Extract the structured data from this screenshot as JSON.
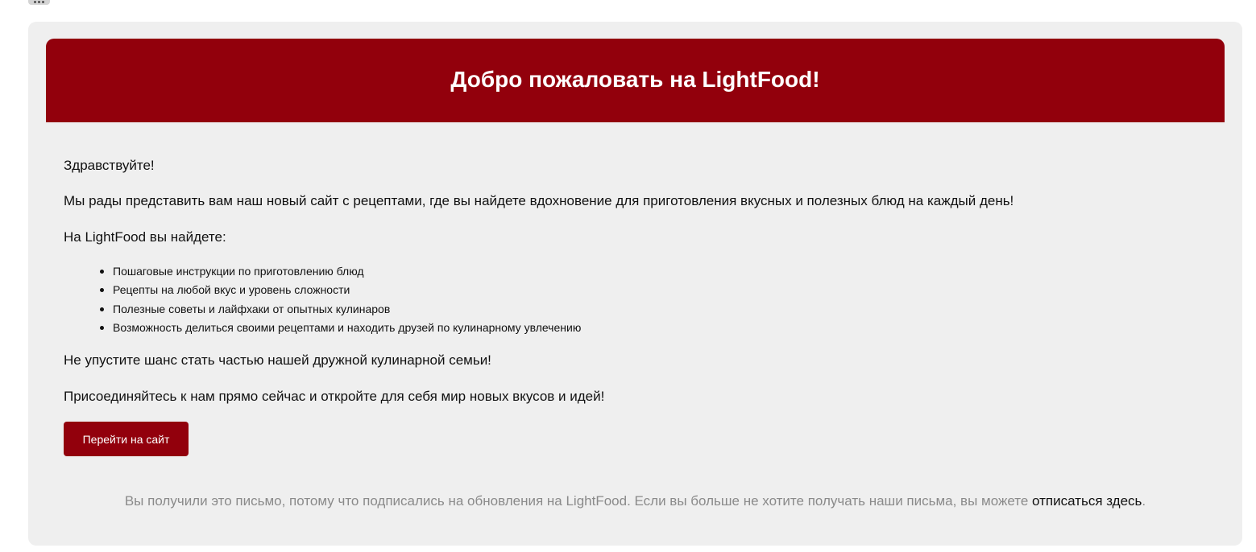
{
  "header": {
    "title": "Добро пожаловать на LightFood!"
  },
  "content": {
    "greeting": "Здравствуйте!",
    "intro": "Мы рады представить вам наш новый сайт с рецептами, где вы найдете вдохновение для приготовления вкусных и полезных блюд на каждый день!",
    "features_title": "На LightFood вы найдете:",
    "features": [
      "Пошаговые инструкции по приготовлению блюд",
      "Рецепты на любой вкус и уровень сложности",
      "Полезные советы и лайфхаки от опытных кулинаров",
      "Возможность делиться своими рецептами и находить друзей по кулинарному увлечению"
    ],
    "outro1": "Не упустите шанс стать частью нашей дружной кулинарной семьи!",
    "outro2": "Присоединяйтесь к нам прямо сейчас и откройте для себя мир новых вкусов и идей!"
  },
  "cta": {
    "label": "Перейти на сайт"
  },
  "footer": {
    "text": "Вы получили это письмо, потому что подписались на обновления на LightFood. Если вы больше не хотите получать наши письма, вы можете ",
    "unsubscribe_label": "отписаться здесь",
    "trailing": "."
  },
  "colors": {
    "brand": "#92000c",
    "card_background": "#efefef",
    "footer_text": "#8a8a8a"
  },
  "icons": {
    "more": "more-horizontal-icon"
  }
}
